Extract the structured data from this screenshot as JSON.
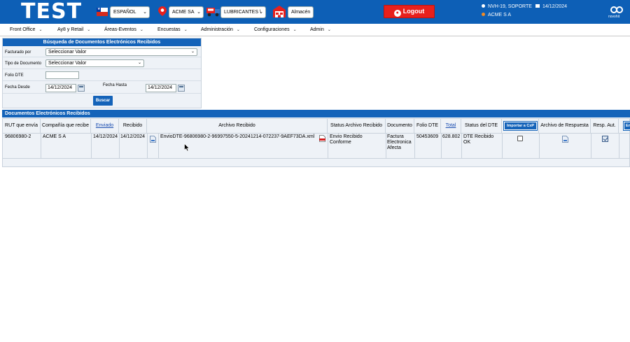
{
  "header": {
    "brand": "TEST",
    "language": "ESPAÑOL",
    "company_select": "ACME SA",
    "business_line": "LUBRICANTES \\",
    "warehouse_button": "Almacén",
    "logout": "Logout",
    "user_info": "NVH-19, SOPORTE",
    "date": "14/12/2024",
    "company_name": "ACME S A",
    "logo_text": "novohit",
    "icons": [
      "chile-flag-icon",
      "location-pin-icon",
      "truck-icon",
      "warehouse-icon",
      "user-icon",
      "calendar-icon",
      "novohit-logo-icon"
    ]
  },
  "menu": [
    {
      "label": "Front Office"
    },
    {
      "label": "Ay8 y Retail"
    },
    {
      "label": "Áreas-Eventos"
    },
    {
      "label": "Encuestas"
    },
    {
      "label": "Administración"
    },
    {
      "label": "Configuraciones"
    },
    {
      "label": "Admin"
    }
  ],
  "search": {
    "title": "Búsqueda de Documentos Electrónicos Recibidos",
    "facturado_label": "Facturado por",
    "facturado_value": "Seleccionar Valor",
    "tipo_label": "Tipo de Documento",
    "tipo_value": "Seleccionar Valor",
    "folio_label": "Folio DTE",
    "folio_value": "",
    "desde_label": "Fecha Desde",
    "desde_value": "14/12/2024",
    "hasta_label": "Fecha Hasta",
    "hasta_value": "14/12/2024",
    "buscar": "Buscar"
  },
  "results": {
    "title": "Documentos Electrónicos Recibidos",
    "columns": [
      "RUT que envía",
      "Compañía que recibe",
      "Enviado",
      "Recibido",
      "Archivo Recibido",
      "Status Archivo Recibido",
      "Documento",
      "Folio DTE",
      "Total",
      "Status del DTE",
      "Importar a CxP",
      "Archivo de Respuesta",
      "Resp. Aut.",
      "En"
    ],
    "rows": [
      {
        "rut": "96806980-2",
        "compania": "ACME S A",
        "enviado": "14/12/2024",
        "recibido": "14/12/2024",
        "archivo": "EnvioDTE-96806980-2-96997550-5-20241214-072237-9AEF73DA.xml",
        "status_archivo_1": "Envio Recibido",
        "status_archivo_2": "Conforme",
        "documento_1": "Factura",
        "documento_2": "Electronica",
        "documento_3": "Afecta",
        "folio": "50453609",
        "total": "628.802",
        "status_dte_1": "DTE Recibido",
        "status_dte_2": "OK",
        "resp_aut_checked": true
      }
    ]
  }
}
